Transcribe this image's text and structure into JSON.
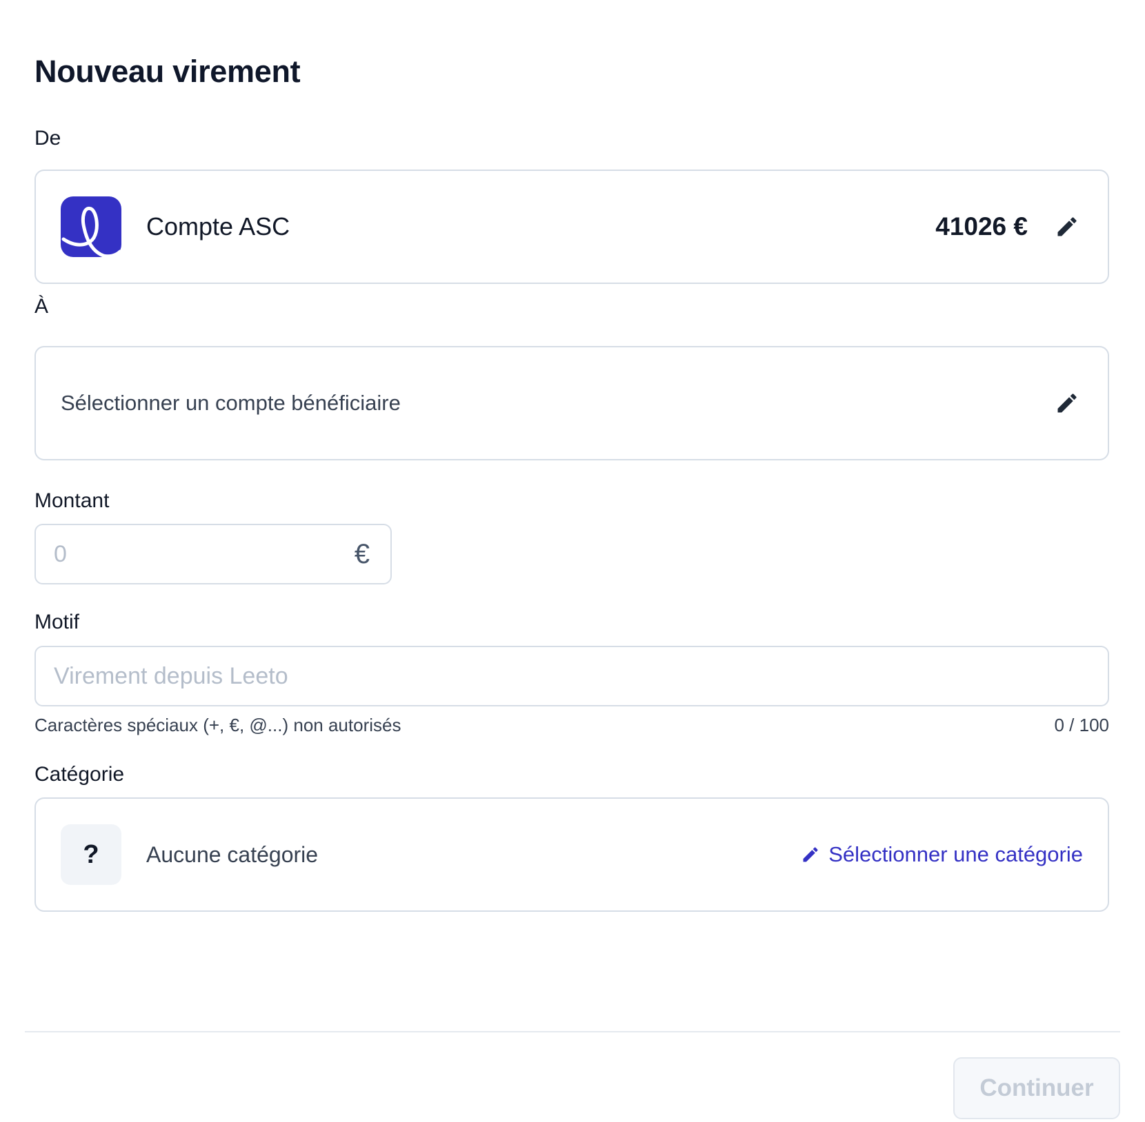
{
  "header": {
    "title": "Nouveau virement"
  },
  "from": {
    "label": "De",
    "account_name": "Compte ASC",
    "balance": "41026 €",
    "logo_color": "#3431c4",
    "edit_icon": "pencil-icon"
  },
  "to": {
    "label": "À",
    "placeholder": "Sélectionner un compte bénéficiaire",
    "edit_icon": "pencil-icon"
  },
  "amount": {
    "label": "Montant",
    "value": "",
    "placeholder": "0",
    "currency": "€"
  },
  "motif": {
    "label": "Motif",
    "value": "",
    "placeholder": "Virement depuis Leeto",
    "hint": "Caractères spéciaux (+, €, @...) non autorisés",
    "counter": "0 / 100"
  },
  "category": {
    "label": "Catégorie",
    "icon_text": "?",
    "current": "Aucune catégorie",
    "select_label": "Sélectionner une catégorie",
    "accent_color": "#3431c4"
  },
  "footer": {
    "continue_label": "Continuer",
    "continue_disabled": true
  }
}
